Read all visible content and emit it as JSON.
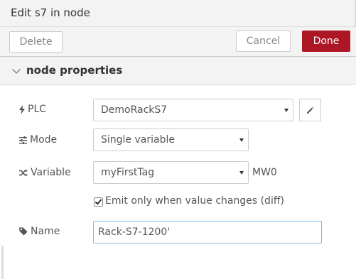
{
  "header": {
    "title": "Edit s7 in node"
  },
  "toolbar": {
    "delete_label": "Delete",
    "cancel_label": "Cancel",
    "done_label": "Done",
    "done_color": "#ad1625"
  },
  "section": {
    "title": "node properties",
    "expanded": true
  },
  "form": {
    "plc": {
      "label": "PLC",
      "icon": "bolt-icon",
      "value": "DemoRackS7"
    },
    "mode": {
      "label": "Mode",
      "icon": "sliders-icon",
      "value": "Single variable"
    },
    "variable": {
      "label": "Variable",
      "icon": "shuffle-icon",
      "value": "myFirstTag",
      "suffix": "MW0"
    },
    "diff": {
      "label": "Emit only when value changes (diff)",
      "checked": true
    },
    "name": {
      "label": "Name",
      "icon": "tag-icon",
      "value": "Rack-S7-1200'"
    }
  }
}
